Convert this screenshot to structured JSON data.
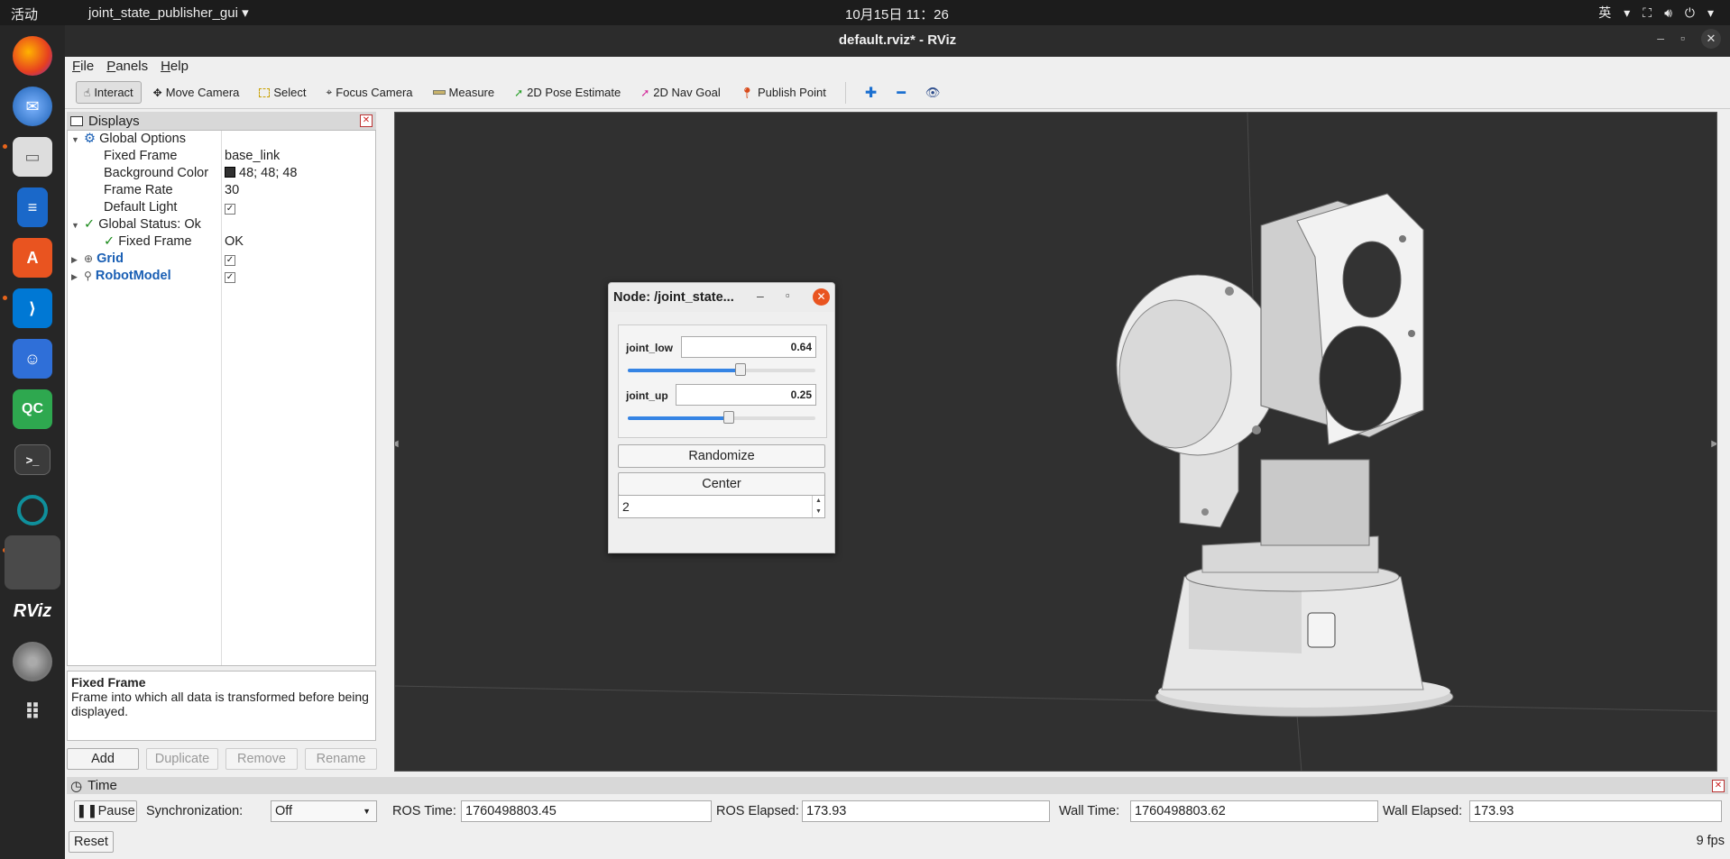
{
  "topbar": {
    "activities": "活动",
    "app_menu": "joint_state_publisher_gui",
    "clock": "10月15日  11：26",
    "input_method": "英"
  },
  "dock": {
    "items": [
      "firefox-icon",
      "thunderbird-icon",
      "files-icon",
      "writer-icon",
      "app-center-icon",
      "vscode-icon",
      "robot-icon",
      "qt-creator-icon",
      "terminal-icon",
      "settings-icon",
      "active-window",
      "rviz-icon",
      "disc-icon",
      "apps-grid-icon"
    ],
    "qc_label": "QC",
    "rviz_label": "RViz",
    "terminal_label": ">_"
  },
  "window": {
    "title": "default.rviz* - RViz"
  },
  "menu": {
    "file": "File",
    "panels": "Panels",
    "help": "Help"
  },
  "toolbar": {
    "interact": "Interact",
    "move_camera": "Move Camera",
    "select": "Select",
    "focus_camera": "Focus Camera",
    "measure": "Measure",
    "pose_estimate": "2D Pose Estimate",
    "nav_goal": "2D Nav Goal",
    "publish_point": "Publish Point"
  },
  "displays": {
    "panel_title": "Displays",
    "global_options": "Global Options",
    "fixed_frame_label": "Fixed Frame",
    "fixed_frame_value": "base_link",
    "bg_color_label": "Background Color",
    "bg_color_value": "48; 48; 48",
    "frame_rate_label": "Frame Rate",
    "frame_rate_value": "30",
    "default_light_label": "Default Light",
    "global_status": "Global Status: Ok",
    "status_fixed_frame": "Fixed Frame",
    "status_fixed_frame_value": "OK",
    "grid": "Grid",
    "robot_model": "RobotModel",
    "desc_title": "Fixed Frame",
    "desc_text": "Frame into which all data is transformed before being displayed.",
    "add": "Add",
    "duplicate": "Duplicate",
    "remove": "Remove",
    "rename": "Rename"
  },
  "node_dialog": {
    "title": "Node: /joint_state...",
    "joint_low_label": "joint_low",
    "joint_low_value": "0.64",
    "joint_low_level": 0.6,
    "joint_up_label": "joint_up",
    "joint_up_value": "0.25",
    "joint_up_level": 0.54,
    "randomize": "Randomize",
    "center": "Center",
    "spin_value": "2"
  },
  "time_panel": {
    "title": "Time",
    "pause": "Pause",
    "sync_label": "Synchronization:",
    "sync_value": "Off",
    "ros_time_label": "ROS Time:",
    "ros_time_value": "1760498803.45",
    "ros_elapsed_label": "ROS Elapsed:",
    "ros_elapsed_value": "173.93",
    "wall_time_label": "Wall Time:",
    "wall_time_value": "1760498803.62",
    "wall_elapsed_label": "Wall Elapsed:",
    "wall_elapsed_value": "173.93",
    "reset": "Reset",
    "fps": "9 fps"
  },
  "colors": {
    "view_background": "#303030",
    "accent": "#3584e4",
    "close_orange": "#e95420"
  }
}
